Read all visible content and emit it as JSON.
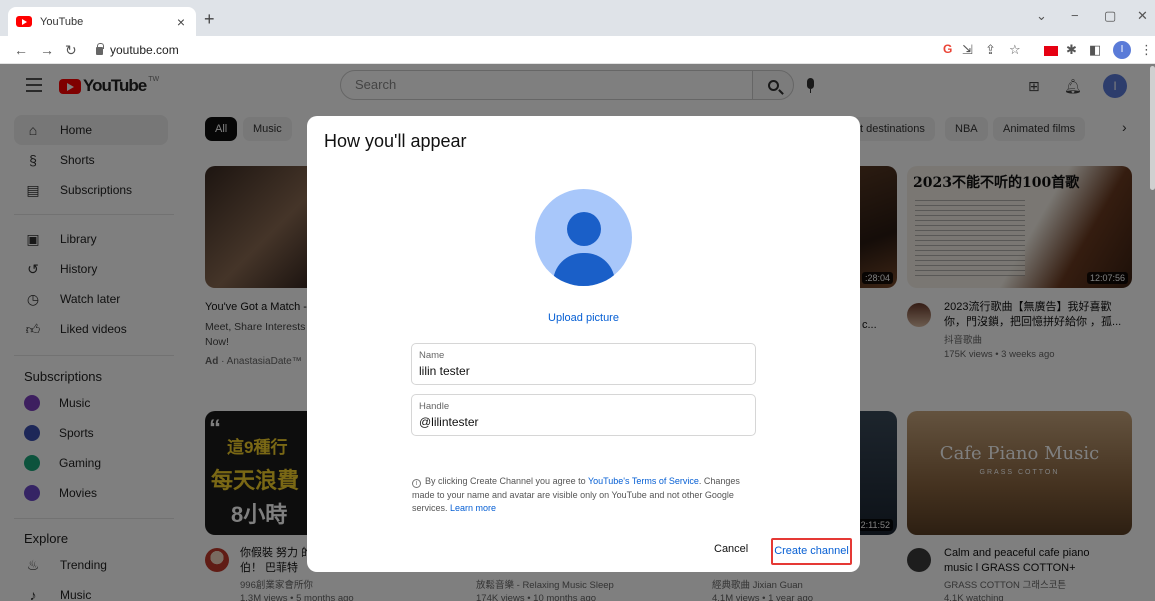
{
  "browser": {
    "tab_title": "YouTube",
    "tab_close": "×",
    "new_tab": "+",
    "url": "youtube.com",
    "profile_initial": "I"
  },
  "header": {
    "logo_text": "YouTube",
    "logo_region": "TW",
    "search_placeholder": "Search",
    "avatar_initial": "I"
  },
  "sidebar": {
    "main": [
      {
        "label": "Home",
        "icon": "home-icon"
      },
      {
        "label": "Shorts",
        "icon": "shorts-icon"
      },
      {
        "label": "Subscriptions",
        "icon": "subscriptions-icon"
      }
    ],
    "library": [
      {
        "label": "Library",
        "icon": "library-icon"
      },
      {
        "label": "History",
        "icon": "history-icon"
      },
      {
        "label": "Watch later",
        "icon": "watch-later-icon"
      },
      {
        "label": "Liked videos",
        "icon": "liked-videos-icon"
      }
    ],
    "subscriptions_heading": "Subscriptions",
    "subscriptions": [
      {
        "label": "Music",
        "color": "#7b3fbf"
      },
      {
        "label": "Sports",
        "color": "#3a4fb0"
      },
      {
        "label": "Gaming",
        "color": "#1aa67a"
      },
      {
        "label": "Movies",
        "color": "#6a48c8"
      }
    ],
    "explore_heading": "Explore",
    "explore": [
      {
        "label": "Trending",
        "icon": "trending-icon"
      },
      {
        "label": "Music",
        "icon": "music-note-icon"
      }
    ]
  },
  "chips": [
    "All",
    "Music",
    "t destinations",
    "NBA",
    "Animated films"
  ],
  "feed": {
    "ad": {
      "title": "You've Got a Match - (",
      "desc_line1": "Meet, Share Interests",
      "desc_line2": "Now!",
      "sponsor_badge": "Ad",
      "sponsor": " · AnastasiaDate™"
    },
    "right_top": {
      "duration": "12:07:56",
      "thumb_text": "2023不能不听的100首歌",
      "title_line1": "2023流行歌曲【無廣告】我好喜歡",
      "title_line2": "你，門沒鎖，把回憶拼好給你 ，孤...",
      "channel": "抖音歌曲",
      "meta": "175K views • 3 weeks ago"
    },
    "mid_top_duration": ":28:04",
    "mid_top_title": "c...",
    "left_bottom": {
      "thumb_line1": "這9種行",
      "thumb_line2": "每天浪費",
      "thumb_line3": "8小時",
      "title": "你假裝 努力 的",
      "title2": "伯！ 巴菲特",
      "meta1": "996創業家會所你",
      "meta2": "1.3M views • 5 months ago"
    },
    "mid_bottom": {
      "meta1": "放鬆音樂 - Relaxing Music Sleep",
      "meta2": "174K views • 10 months ago"
    },
    "mid2_bottom": {
      "duration": "2:11:52",
      "meta1": "經典歌曲 Jixian Guan",
      "meta2": "4.1M views • 1 year ago"
    },
    "right_bottom": {
      "thumb_text": "Cafe Piano Music",
      "thumb_sub": "GRASS COTTON",
      "title_line1": "Calm and peaceful cafe piano",
      "title_line2": "music l GRASS COTTON+",
      "channel": "GRASS COTTON 그래스코튼",
      "meta": "4.1K watching"
    }
  },
  "dialog": {
    "title": "How you'll appear",
    "upload_label": "Upload picture",
    "name_label": "Name",
    "name_value": "lilin tester",
    "handle_label": "Handle",
    "handle_value": "@lilintester",
    "notice_before": "By clicking Create Channel you agree to ",
    "notice_link": "YouTube's Terms of Service",
    "notice_after": ". Changes made to your name and avatar are visible only on YouTube and not other Google services. ",
    "learn_more": "Learn more",
    "cancel_label": "Cancel",
    "create_label": "Create channel",
    "highlight_color": "#e53935"
  }
}
